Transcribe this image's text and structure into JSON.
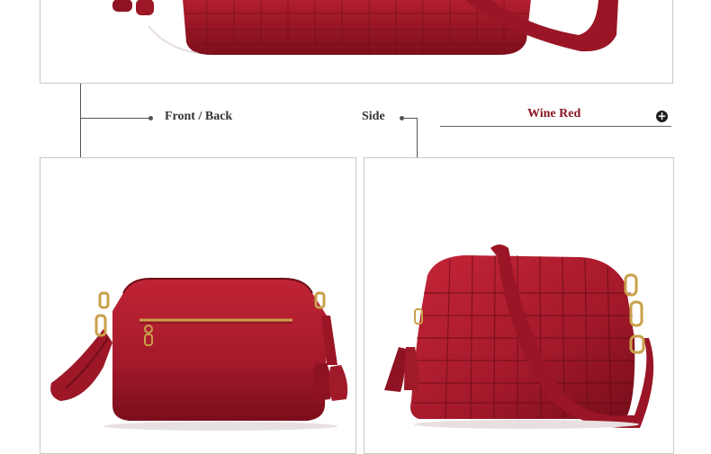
{
  "labels": {
    "front_back": "Front / Back",
    "side": "Side"
  },
  "color_option": {
    "name": "Wine Red",
    "icon": "plus-circle-icon"
  },
  "colors": {
    "wine": "#a3192a",
    "wine_dark": "#6e0e18",
    "gold": "#c9a04a"
  }
}
